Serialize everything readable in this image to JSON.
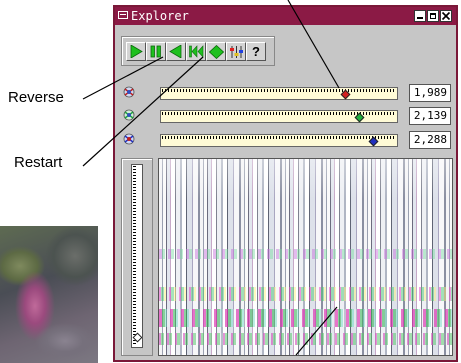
{
  "callouts": {
    "reverse": "Reverse",
    "restart": "Restart"
  },
  "window": {
    "title": "Explorer"
  },
  "toolbar": {
    "buttons": [
      "play",
      "pause",
      "reverse",
      "restart",
      "step",
      "settings",
      "help"
    ],
    "help_label": "?"
  },
  "sliders": [
    {
      "value": "1,989",
      "position": 0.78,
      "color": "#d42020"
    },
    {
      "value": "2,139",
      "position": 0.84,
      "color": "#20b040"
    },
    {
      "value": "2,288",
      "position": 0.9,
      "color": "#2030c0"
    }
  ],
  "vertical_slider": {
    "position": 0.95
  },
  "colors": {
    "title_bar": "#8b1a45",
    "play_green": "#1ec01e",
    "track_fill": "#fffbd6"
  }
}
